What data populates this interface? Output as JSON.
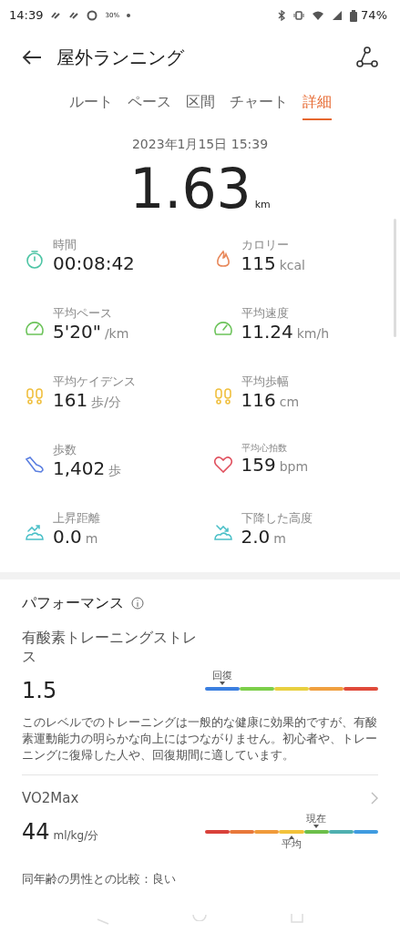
{
  "status_bar": {
    "time": "14:39",
    "badge_text": "30%",
    "battery": "74%"
  },
  "header": {
    "title": "屋外ランニング"
  },
  "tabs": [
    {
      "label": "ルート",
      "selected": false
    },
    {
      "label": "ペース",
      "selected": false
    },
    {
      "label": "区間",
      "selected": false
    },
    {
      "label": "チャート",
      "selected": false
    },
    {
      "label": "詳細",
      "selected": true
    }
  ],
  "summary": {
    "date": "2023年1月15日 15:39",
    "distance": "1.63",
    "unit": "km"
  },
  "metrics": [
    {
      "kind": "timer",
      "color": "#4cc4a4",
      "label": "時間",
      "label_small": false,
      "value": "00:08:42"
    },
    {
      "kind": "flame",
      "color": "#e8885a",
      "label": "カロリー",
      "label_small": false,
      "value": "115",
      "unit": "kcal"
    },
    {
      "kind": "gauge",
      "color": "#6cc35a",
      "label": "平均ペース",
      "label_small": false,
      "value": "5'20\"",
      "unit": "/km"
    },
    {
      "kind": "gauge",
      "color": "#6cc35a",
      "label": "平均速度",
      "label_small": false,
      "value": "11.24",
      "unit": "km/h"
    },
    {
      "kind": "footprints",
      "color": "#f0c040",
      "label": "平均ケイデンス",
      "label_small": false,
      "value": "161",
      "unit": "歩/分"
    },
    {
      "kind": "footprints",
      "color": "#f0c040",
      "label": "平均歩幅",
      "label_small": false,
      "value": "116",
      "unit": "cm"
    },
    {
      "kind": "shoe",
      "color": "#5a7ee0",
      "label": "歩数",
      "label_small": false,
      "value": "1,402",
      "unit": "歩"
    },
    {
      "kind": "heart",
      "color": "#e0505e",
      "label": "平均心拍数",
      "label_small": true,
      "value": "159",
      "unit": "bpm"
    },
    {
      "kind": "ascent",
      "color": "#4cc0c8",
      "label": "上昇距離",
      "label_small": false,
      "value": "0.0",
      "unit": "m"
    },
    {
      "kind": "descent",
      "color": "#4cc0c8",
      "label": "下降した高度",
      "label_small": false,
      "value": "2.0",
      "unit": "m"
    }
  ],
  "performance": {
    "title": "パフォーマンス",
    "training_stress": {
      "label": "有酸素トレーニングストレス",
      "value": "1.5",
      "marker": {
        "label": "回復"
      },
      "segments": [
        {
          "color": "#3b7fe0",
          "marked": true
        },
        {
          "color": "#7ccf4a",
          "marked": false
        },
        {
          "color": "#e8d040",
          "marked": false
        },
        {
          "color": "#f0a040",
          "marked": false
        },
        {
          "color": "#e04a3a",
          "marked": false
        }
      ],
      "description": "このレベルでのトレーニングは一般的な健康に効果的ですが、有酸素運動能力の明らかな向上にはつながりません。初心者や、トレーニングに復帰した人や、回復期間に適しています。"
    },
    "vo2max": {
      "label": "VO2Max",
      "value": "44",
      "unit": "ml/kg/分",
      "current": {
        "label": "現在"
      },
      "average": {
        "label": "平均"
      },
      "segments": [
        {
          "color": "#d9413a",
          "current": false,
          "average": false
        },
        {
          "color": "#e8783a",
          "current": false,
          "average": false
        },
        {
          "color": "#f09a3a",
          "current": false,
          "average": false
        },
        {
          "color": "#f2c23a",
          "current": false,
          "average": true
        },
        {
          "color": "#6cbf4a",
          "current": true,
          "average": false
        },
        {
          "color": "#4fb0b0",
          "current": false,
          "average": false
        },
        {
          "color": "#3f9be0",
          "current": false,
          "average": false
        }
      ],
      "comparison": "同年齢の男性との比較：良い"
    }
  }
}
